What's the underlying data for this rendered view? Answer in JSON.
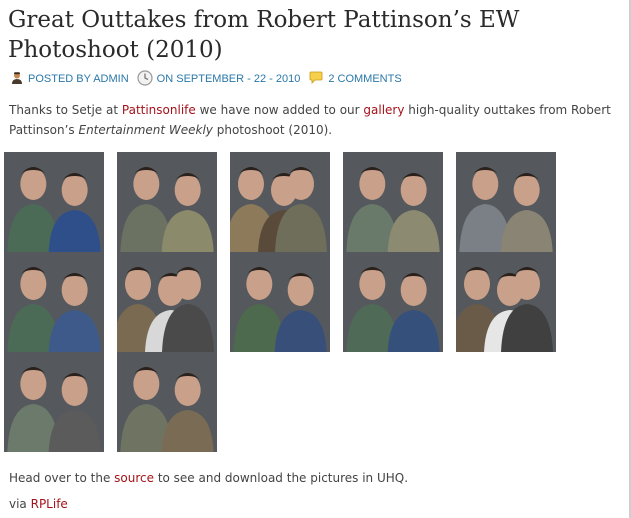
{
  "post": {
    "title": "Great Outtakes from Robert Pattinson’s EW Photoshoot (2010)",
    "meta": {
      "author_prefix": "POSTED BY ",
      "author": "ADMIN",
      "date_prefix": "ON ",
      "date": "SEPTEMBER - 22 - 2010",
      "comments": "2 COMMENTS"
    },
    "intro": {
      "t1": "Thanks to Setje at ",
      "link1": "Pattinsonlife",
      "t2": " we have now added to our ",
      "link2": "gallery",
      "t3": " high-quality outtakes from Robert Pattinson’s ",
      "em": "Entertainment Weekly",
      "t4": " photoshoot (2010)."
    },
    "outro": {
      "t1": "Head over to the ",
      "link": "source",
      "t2": " to see and download the pictures in UHQ."
    },
    "via": {
      "t1": "via ",
      "link": "RPLife"
    }
  },
  "colors": {
    "link": "#a5121a",
    "meta_link": "#2a78a8",
    "title": "#2a2a2a"
  },
  "icons": [
    "user-icon",
    "clock-icon",
    "comment-bubble-icon"
  ],
  "gallery": {
    "thumbnail_count": 12,
    "thumbnails": [
      {
        "name": "photo-1",
        "subject": "taylor-and-robert"
      },
      {
        "name": "photo-2",
        "subject": "robert-and-taylor-standing"
      },
      {
        "name": "photo-3",
        "subject": "taylor-kristen-robert"
      },
      {
        "name": "photo-4",
        "subject": "robert-and-taylor-shirts"
      },
      {
        "name": "photo-5",
        "subject": "robert-and-taylor-close"
      },
      {
        "name": "photo-6",
        "subject": "taylor-and-robert-closeup"
      },
      {
        "name": "photo-7",
        "subject": "taylor-kristen-robert-smiling"
      },
      {
        "name": "photo-8",
        "subject": "taylor-and-robert-tshirts"
      },
      {
        "name": "photo-9",
        "subject": "taylor-and-robert-portrait"
      },
      {
        "name": "photo-10",
        "subject": "taylor-kristen-robert-group"
      },
      {
        "name": "photo-11",
        "subject": "robert-and-taylor-plaid"
      },
      {
        "name": "photo-12",
        "subject": "robert-and-taylor-jacket"
      }
    ]
  }
}
